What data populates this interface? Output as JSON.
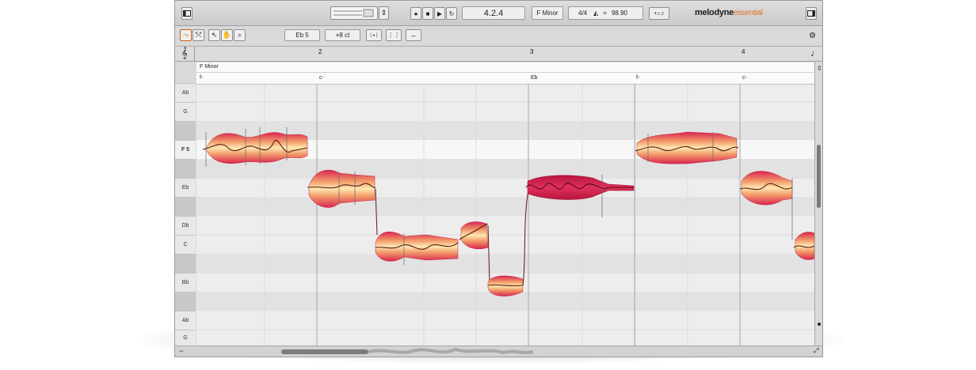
{
  "transport": {
    "position": "4.2.4",
    "key": "F Minor",
    "meter": "4/4",
    "tempo_sep": "=",
    "tempo": "98.90"
  },
  "logo": {
    "main": "melodyne",
    "edition": "essential"
  },
  "toolbar": {
    "pitch_value": "Eb 5",
    "cents_value": "+8 ct"
  },
  "ruler": {
    "bars": [
      "2",
      "3",
      "4"
    ]
  },
  "scale_label": "F Minor",
  "chords": [
    "f-",
    "c-",
    "Eb",
    "f-",
    "c-"
  ],
  "pitch_labels": [
    "Ab",
    "G",
    "F 5",
    "Eb",
    "Db",
    "C",
    "Bb",
    "Ab",
    "G"
  ],
  "colors": {
    "blob_outer": "#d9254f",
    "blob_inner": "#fde8b0",
    "pitch_line": "#5a1a10",
    "accent": "#e07020"
  }
}
